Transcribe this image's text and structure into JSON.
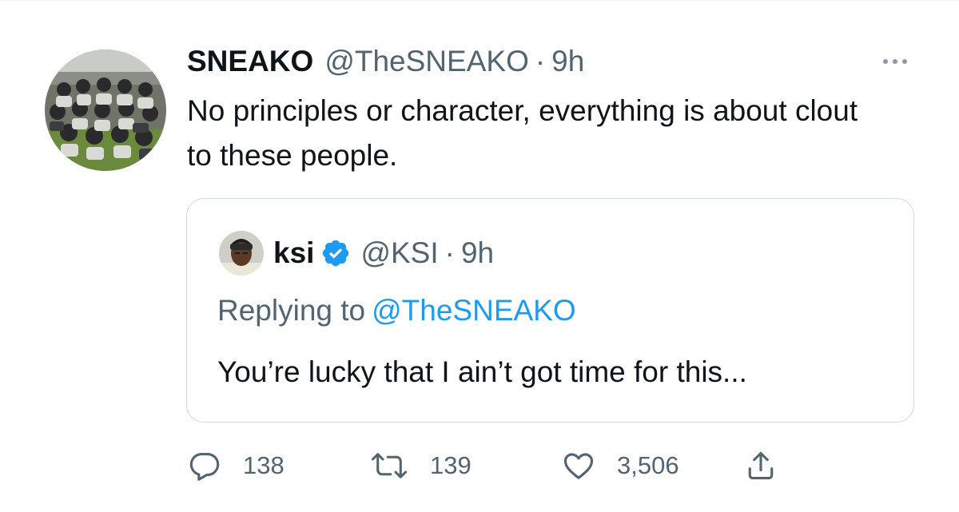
{
  "tweet": {
    "display_name": "SNEAKO",
    "handle": "@TheSNEAKO",
    "separator": "·",
    "time": "9h",
    "text": "No principles or character, everything is about clout to these people.",
    "more_icon": "ellipsis-icon"
  },
  "quoted_tweet": {
    "display_name": "ksi",
    "verified": true,
    "handle": "@KSI",
    "separator": "·",
    "time": "9h",
    "replying_label": "Replying to",
    "replying_handle": "@TheSNEAKO",
    "text": "You’re lucky that I ain’t got time for this..."
  },
  "actions": {
    "replies": "138",
    "retweets": "139",
    "likes": "3,506"
  },
  "colors": {
    "primary_text": "#0f1419",
    "secondary_text": "#536471",
    "accent": "#1d9bf0",
    "border": "#cfd9de"
  }
}
